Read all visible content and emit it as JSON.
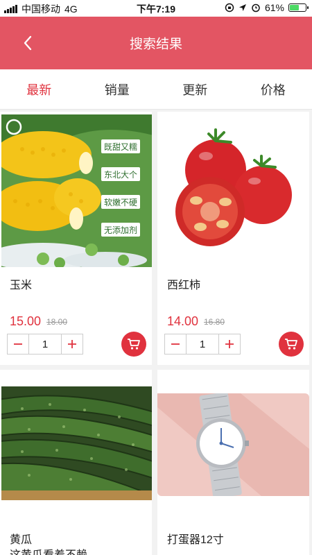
{
  "status_bar": {
    "carrier": "中国移动",
    "network": "4G",
    "time": "下午7:19",
    "battery": "61%",
    "battery_level": 0.61
  },
  "header": {
    "title": "搜索结果"
  },
  "tabs": [
    {
      "label": "最新",
      "active": true
    },
    {
      "label": "销量",
      "active": false
    },
    {
      "label": "更新",
      "active": false
    },
    {
      "label": "价格",
      "active": false
    }
  ],
  "products": [
    {
      "name": "玉米",
      "price": "15.00",
      "old_price": "18.00",
      "quantity": "1",
      "image_labels": [
        "既甜又糯",
        "东北大个",
        "软嫩不硬",
        "无添加剂"
      ]
    },
    {
      "name": "西红柿",
      "price": "14.00",
      "old_price": "16.80",
      "quantity": "1"
    },
    {
      "name": "黄瓜",
      "subtitle": "这黄瓜看着不赖"
    },
    {
      "name": "打蛋器12寸"
    }
  ],
  "colors": {
    "header": "#e35563",
    "accent": "#e0323e"
  }
}
